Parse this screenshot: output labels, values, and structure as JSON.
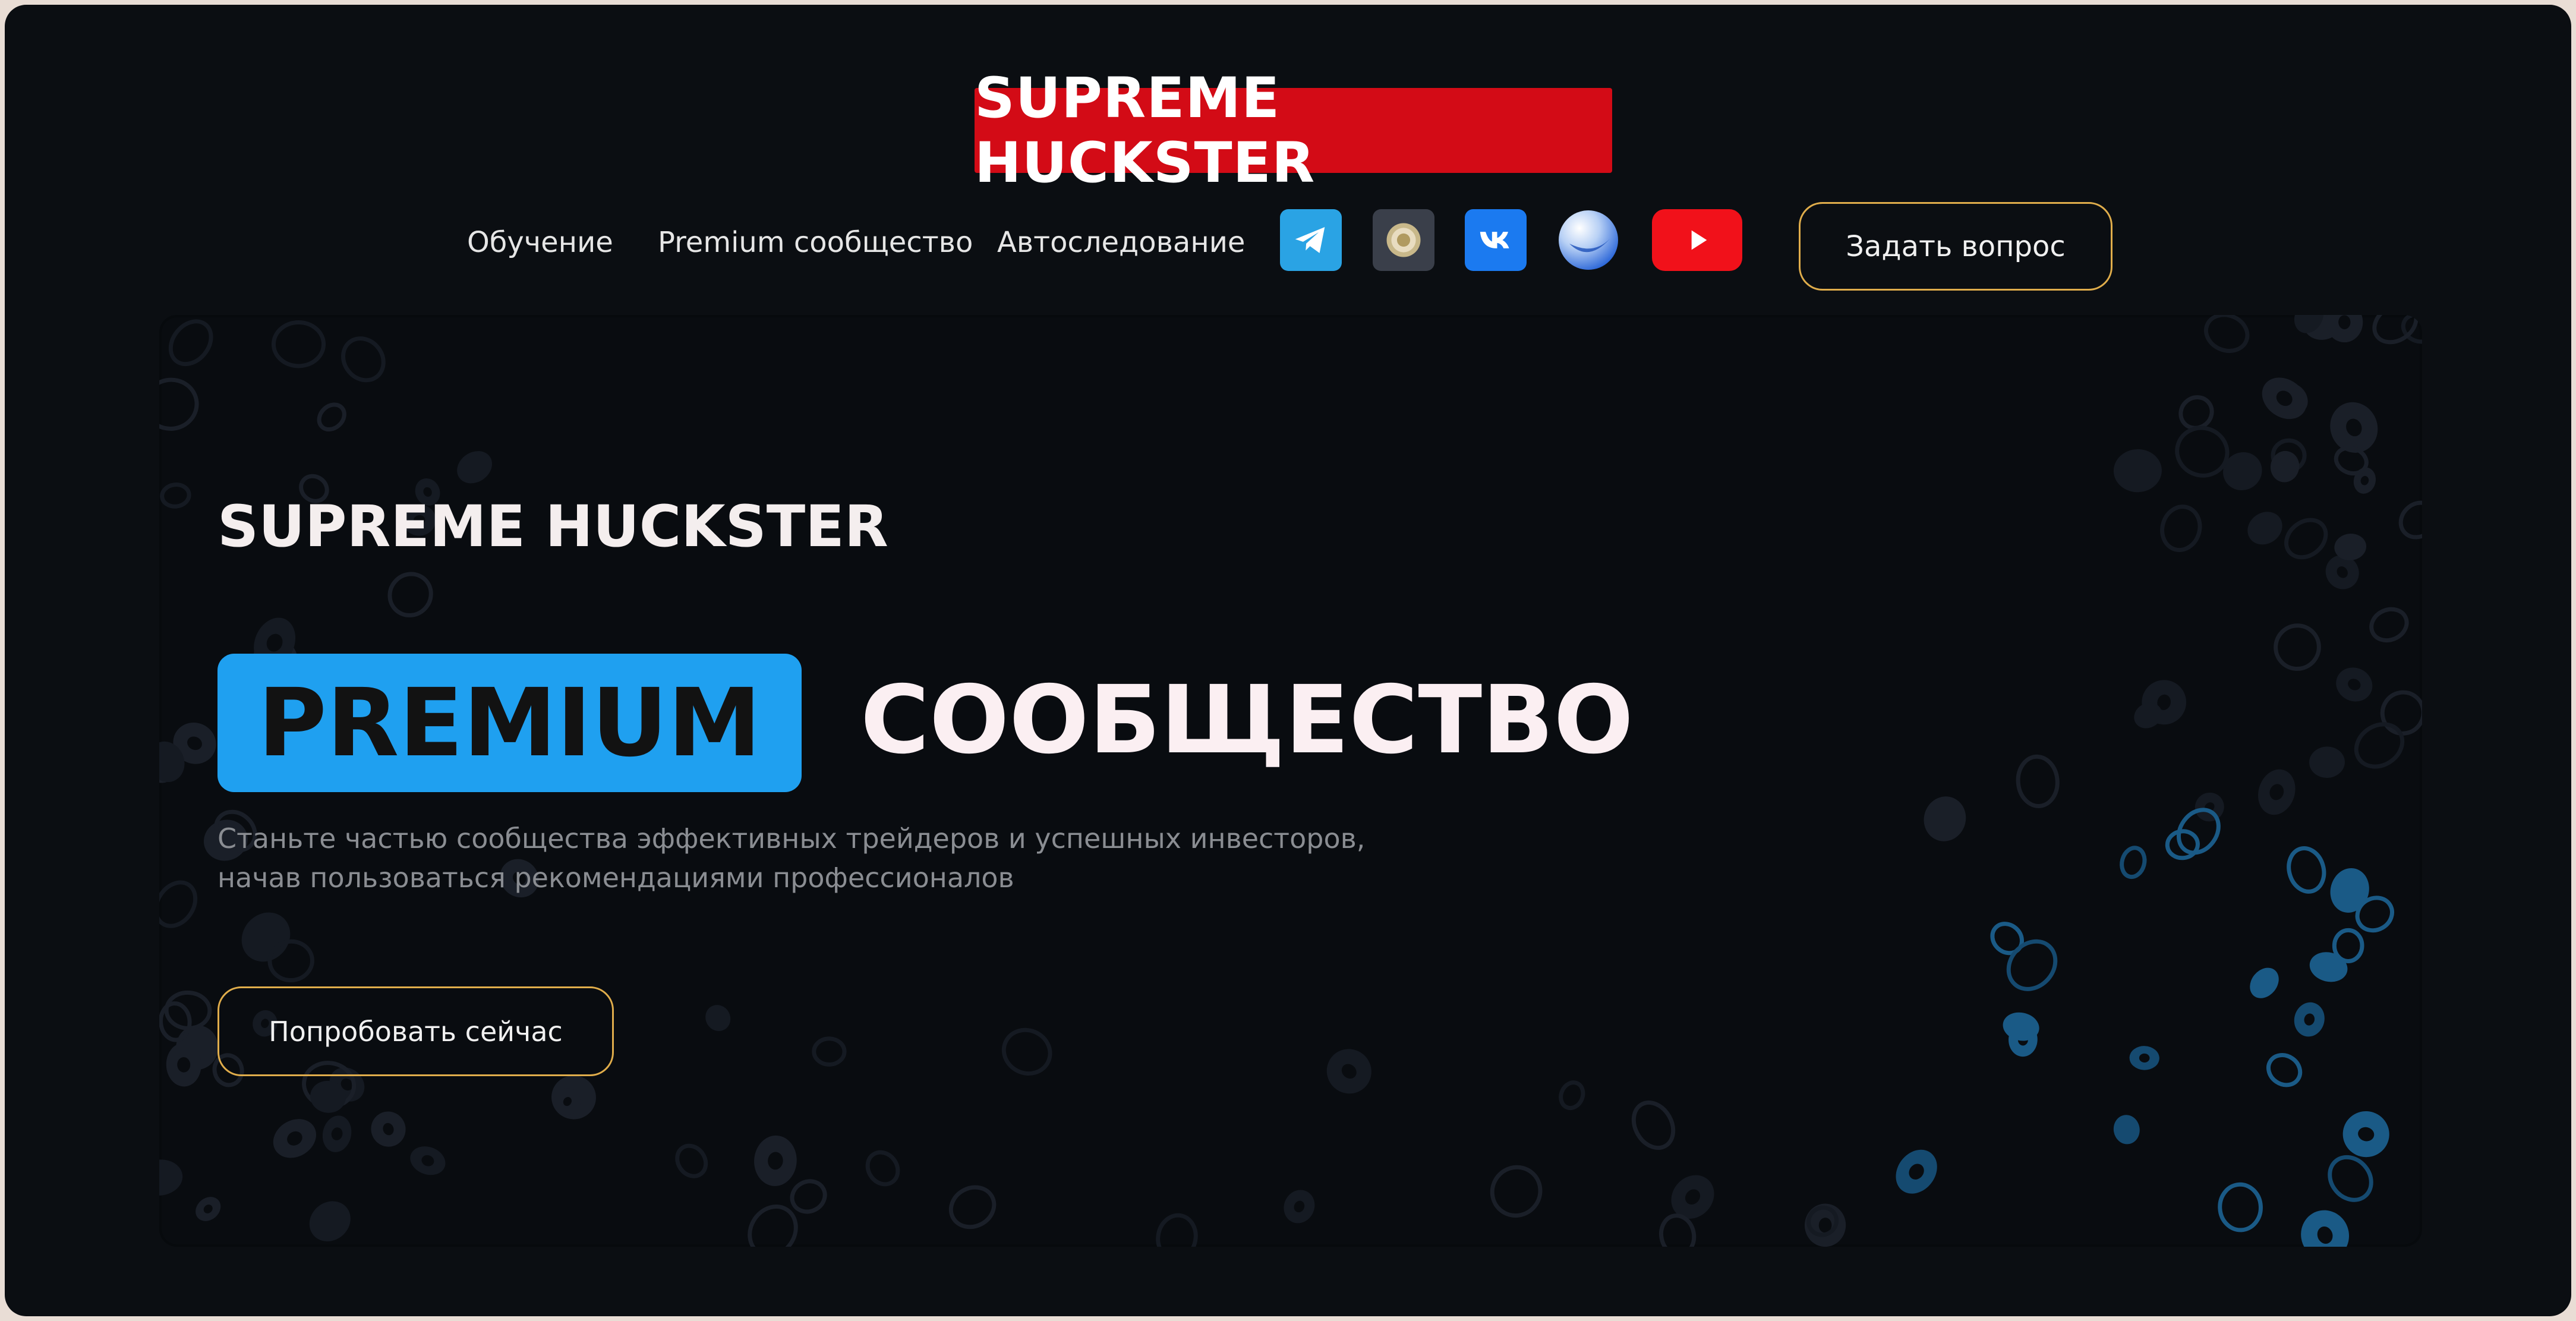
{
  "header": {
    "logo_text": "SUPREME HUCKSTER",
    "nav": [
      {
        "label": "Обучение"
      },
      {
        "label": "Premium сообщество"
      },
      {
        "label": "Автоследование"
      }
    ],
    "socials": [
      "telegram-icon",
      "emblem-icon",
      "vk-icon",
      "sphere-icon",
      "youtube-icon"
    ],
    "ask_button": "Задать вопрос"
  },
  "hero": {
    "brand": "SUPREME HUCKSTER",
    "badge": "PREMIUM",
    "title": "СООБЩЕСТВО",
    "description_line1": "Станьте частью сообщества эффективных трейдеров и успешных инвесторов,",
    "description_line2": "начав пользоваться рекомендациями профессионалов",
    "cta": "Попробовать сейчас"
  },
  "colors": {
    "background": "#0b0e12",
    "logo_red": "#d30b16",
    "accent_blue": "#1fa0f0",
    "button_border": "#e0ad4b"
  }
}
